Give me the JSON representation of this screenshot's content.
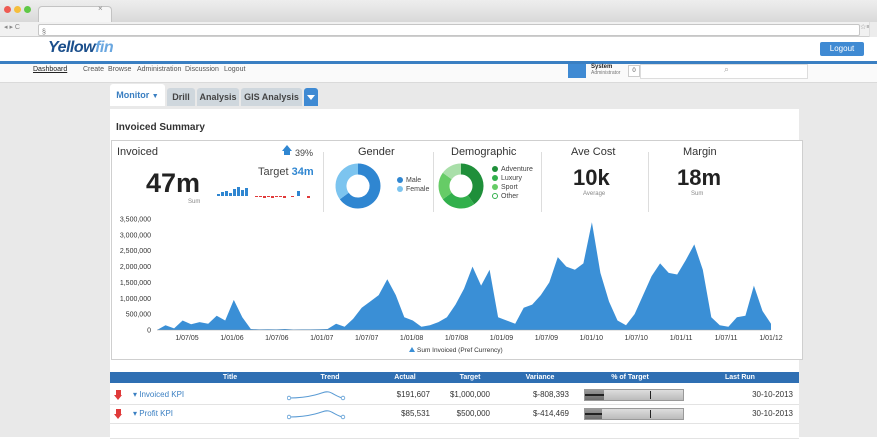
{
  "browser": {
    "url": "§"
  },
  "app": {
    "logo_main": "Yellow",
    "logo_accent": "fin",
    "logout": "Logout"
  },
  "nav": [
    "Dashboard",
    "Create",
    "Browse",
    "Administration",
    "Discussion",
    "Logout"
  ],
  "user": {
    "name": "System",
    "role": "Administrator",
    "notifications": "0"
  },
  "tabs": {
    "active": "Monitor",
    "items": [
      "Drill",
      "Analysis",
      "GIS Analysis"
    ]
  },
  "summary": {
    "heading": "Invoiced Summary",
    "invoiced": {
      "label": "Invoiced",
      "change": "39%",
      "value": "47m",
      "unit": "Sum",
      "target_label": "Target",
      "target_value": "34m"
    },
    "gender": {
      "label": "Gender",
      "legend": [
        "Male",
        "Female"
      ],
      "shares": [
        0.65,
        0.35
      ],
      "colors": [
        "#2f86d1",
        "#7cc4ef"
      ]
    },
    "demographic": {
      "label": "Demographic",
      "legend": [
        "Adventure",
        "Luxury",
        "Sport",
        "Other"
      ],
      "shares": [
        0.4,
        0.25,
        0.2,
        0.15
      ],
      "colors": [
        "#1f8f3a",
        "#32b04c",
        "#66cc66",
        "#a9dfa9"
      ]
    },
    "ave_cost": {
      "label": "Ave Cost",
      "value": "10k",
      "unit": "Average"
    },
    "margin": {
      "label": "Margin",
      "value": "18m",
      "unit": "Sum"
    }
  },
  "chart_data": {
    "type": "area",
    "x": [
      "1/07/05",
      "1/01/06",
      "1/07/06",
      "1/01/07",
      "1/07/07",
      "1/01/08",
      "1/07/08",
      "1/01/09",
      "1/07/09",
      "1/01/10",
      "1/07/10",
      "1/01/11",
      "1/07/11",
      "1/01/12"
    ],
    "yticks": [
      "3,500,000",
      "3,000,000",
      "2,500,000",
      "2,000,000",
      "1,500,000",
      "1,000,000",
      "500,000",
      "0"
    ],
    "ylim": [
      0,
      3500000
    ],
    "series": [
      {
        "name": "Sum Invoiced (Pref Currency)",
        "color": "#3a8fd6",
        "values": [
          0,
          150000,
          50000,
          300000,
          180000,
          250000,
          200000,
          450000,
          300000,
          950000,
          400000,
          30000,
          20000,
          25000,
          20000,
          30000,
          15000,
          20000,
          20000,
          25000,
          30000,
          200000,
          100000,
          350000,
          700000,
          900000,
          1100000,
          1600000,
          1100000,
          400000,
          300000,
          100000,
          150000,
          250000,
          400000,
          800000,
          1300000,
          2000000,
          1400000,
          1900000,
          400000,
          300000,
          200000,
          700000,
          800000,
          1100000,
          1500000,
          2300000,
          2000000,
          1900000,
          2100000,
          3400000,
          1800000,
          900000,
          300000,
          150000,
          500000,
          1100000,
          1700000,
          2100000,
          1800000,
          1750000,
          2200000,
          2700000,
          1900000,
          400000,
          150000,
          100000,
          400000,
          450000,
          1400000,
          600000,
          200000
        ]
      }
    ]
  },
  "table": {
    "headers": [
      "Title",
      "Trend",
      "Actual",
      "Target",
      "Variance",
      "% of Target",
      "Last Run"
    ],
    "rows": [
      {
        "title": "Invoiced KPI",
        "actual": "$191,607",
        "target": "$1,000,000",
        "variance": "$-808,393",
        "pct": 0.19,
        "last_run": "30-10-2013"
      },
      {
        "title": "Profit KPI",
        "actual": "$85,531",
        "target": "$500,000",
        "variance": "$-414,469",
        "pct": 0.17,
        "last_run": "30-10-2013"
      }
    ]
  }
}
